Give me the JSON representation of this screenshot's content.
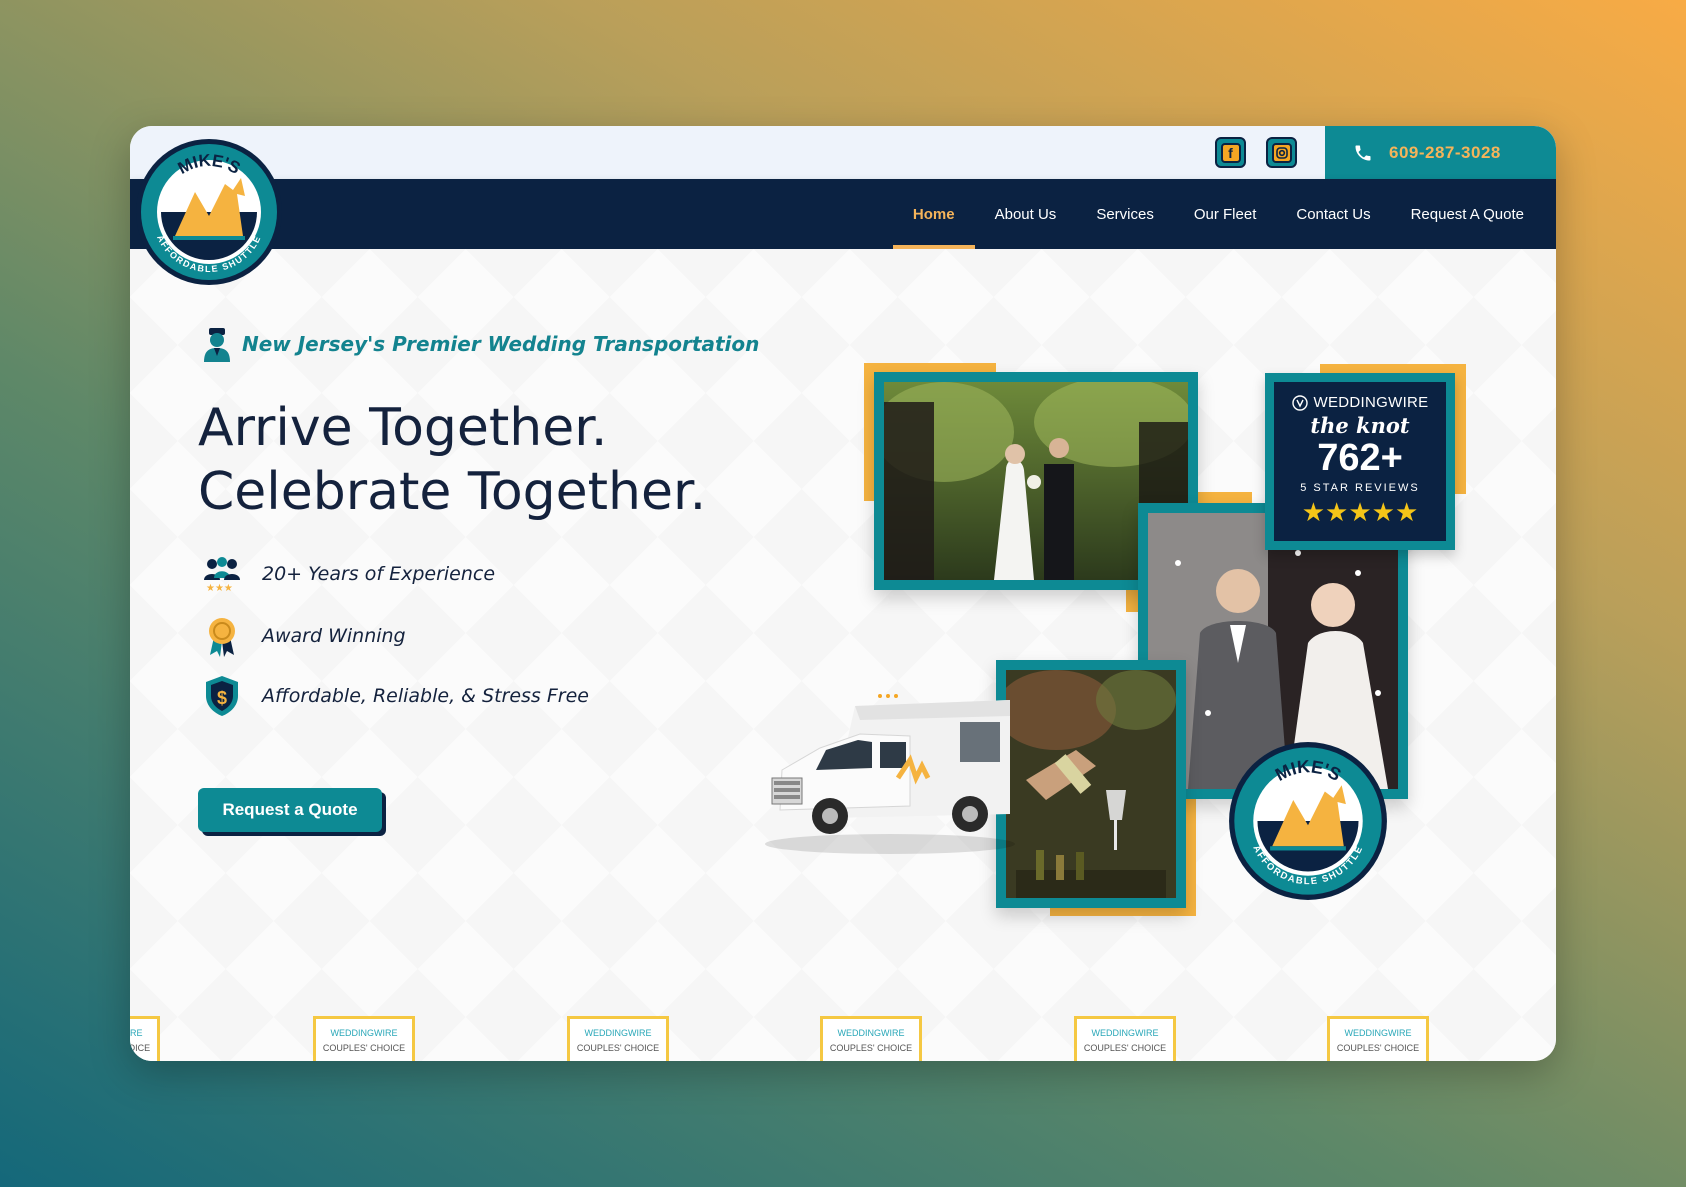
{
  "brand": {
    "logo_top_text": "MIKE'S",
    "logo_bottom_text": "AFFORDABLE SHUTTLE"
  },
  "header": {
    "phone": "609-287-3028"
  },
  "nav": {
    "items": [
      {
        "label": "Home"
      },
      {
        "label": "About Us"
      },
      {
        "label": "Services"
      },
      {
        "label": "Our Fleet"
      },
      {
        "label": "Contact Us"
      },
      {
        "label": "Request A Quote"
      }
    ],
    "active": "Home"
  },
  "hero": {
    "tagline": "New Jersey's Premier Wedding Transportation",
    "headline_line1": "Arrive Together.",
    "headline_line2": "Celebrate Together.",
    "features": [
      {
        "text": "20+ Years of Experience",
        "icon": "team-stars-icon"
      },
      {
        "text": "Award Winning",
        "icon": "award-ribbon-icon"
      },
      {
        "text": "Affordable, Reliable, & Stress Free",
        "icon": "shield-dollar-icon"
      }
    ],
    "cta_label": "Request a Quote"
  },
  "reviews": {
    "source1": "WEDDINGWIRE",
    "source2": "the knot",
    "count": "762+",
    "caption": "5 STAR REVIEWS",
    "stars": "★★★★★"
  },
  "badges": {
    "line1": "WEDDINGWIRE",
    "line2": "COUPLES' CHOICE"
  },
  "colors": {
    "navy": "#0b2242",
    "teal": "#0d8a94",
    "gold": "#f5b340"
  }
}
